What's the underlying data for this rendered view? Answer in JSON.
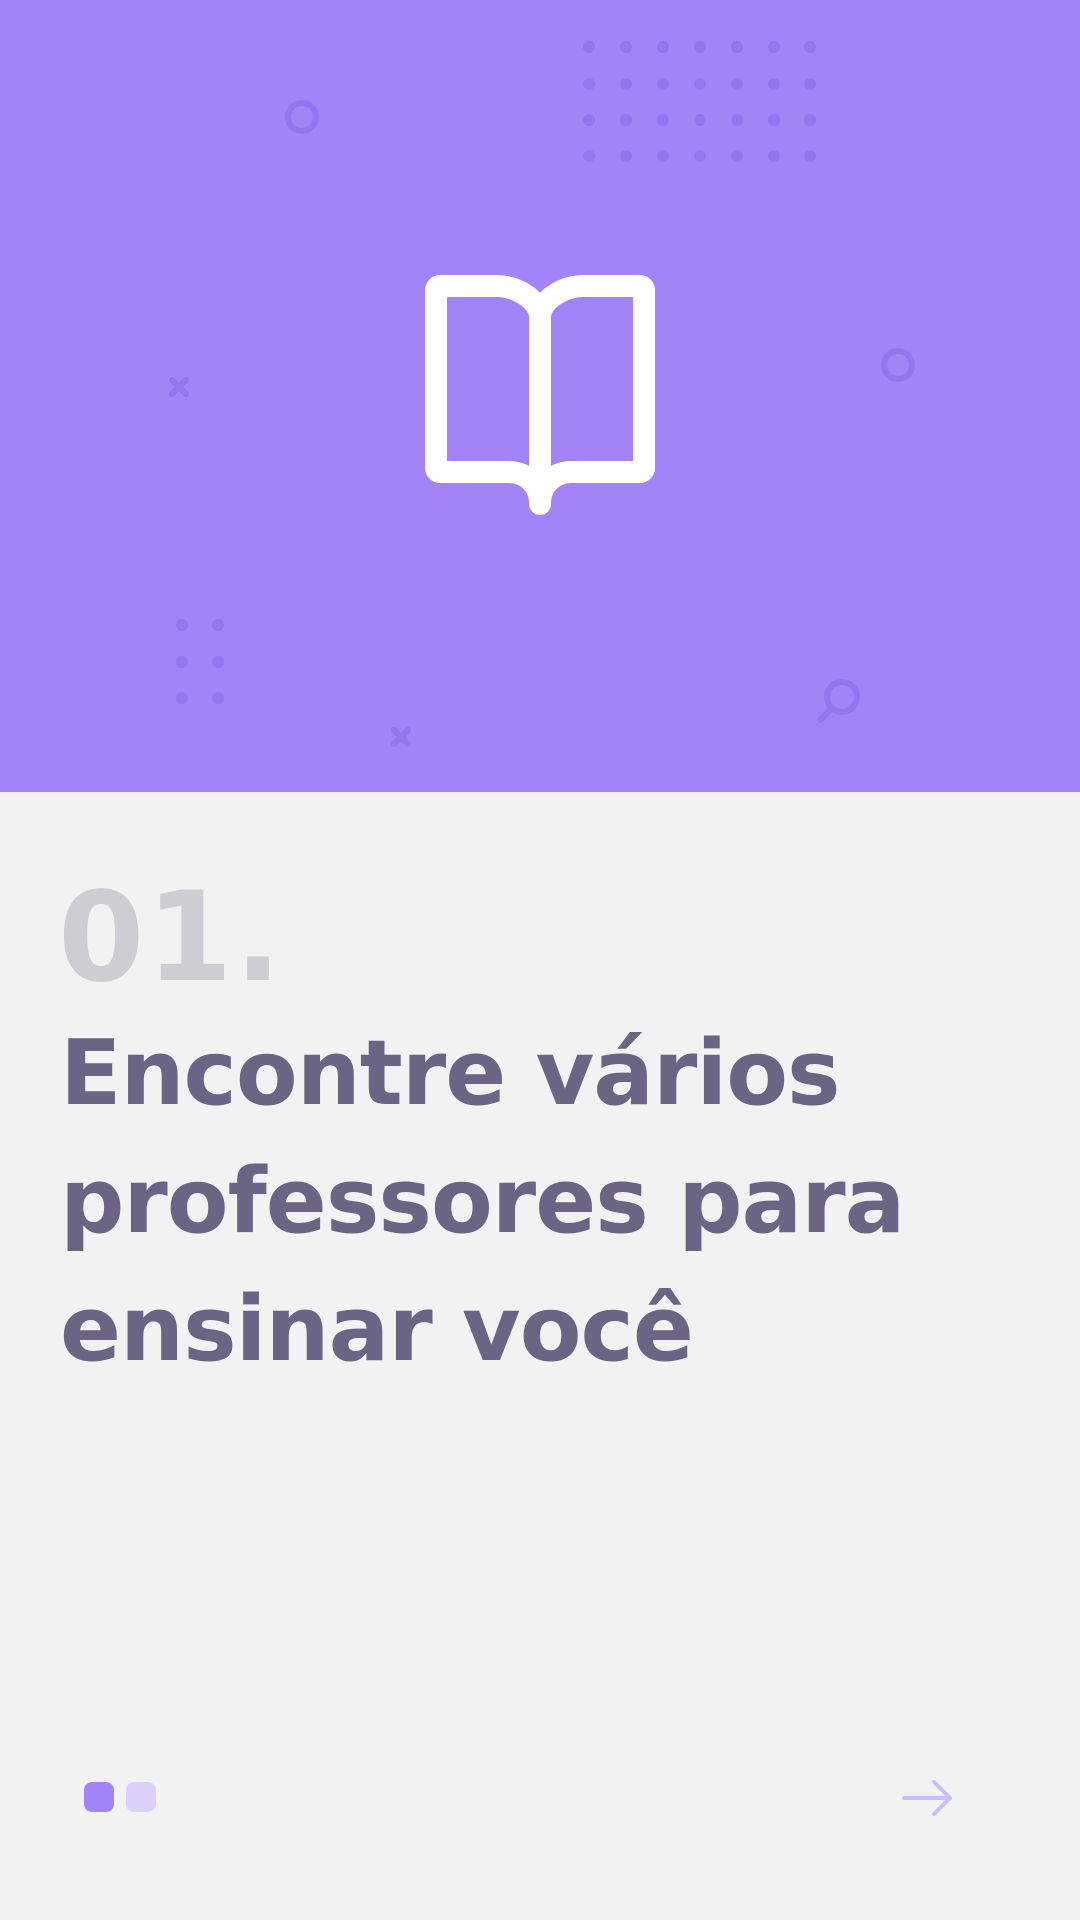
{
  "onboarding": {
    "step_number": "01.",
    "headline": "Encontre vários professores para ensinar você",
    "total_steps": 2,
    "current_step": 1
  },
  "colors": {
    "hero_background": "#a383f7",
    "decoration": "#9574ef",
    "step_number": "#cfcdd4",
    "headline": "#6b6485",
    "pager_active": "#a383f7",
    "pager_inactive": "#dcd0fb",
    "next_arrow": "#cbbdf9"
  },
  "icons": {
    "hero": "open-book-icon",
    "next": "arrow-right-icon"
  }
}
